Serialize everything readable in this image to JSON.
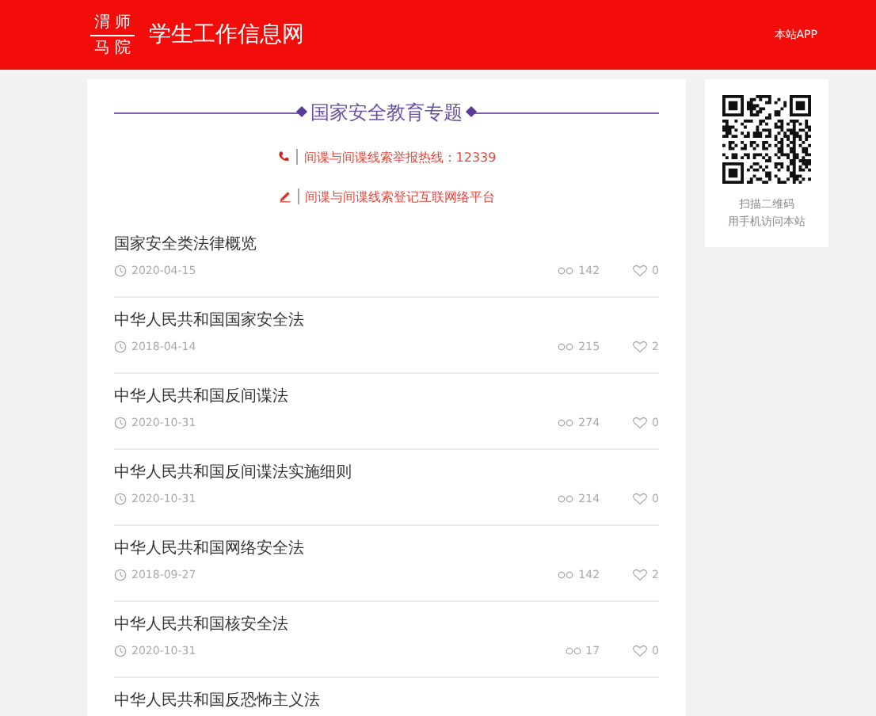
{
  "header": {
    "logo_lines": [
      "渭 师",
      "马 院"
    ],
    "site_title": "学生工作信息网",
    "app_link": "本站APP"
  },
  "topic": {
    "title": "国家安全教育专题",
    "notices": [
      {
        "kind": "phone",
        "text": "间谍与间谍线索举报热线：12339"
      },
      {
        "kind": "pen",
        "text": "间谍与间谍线索登记互联网络平台"
      }
    ]
  },
  "articles": [
    {
      "title": "国家安全类法律概览",
      "date": "2020-04-15",
      "views": "142",
      "likes": "0"
    },
    {
      "title": "中华人民共和国国家安全法",
      "date": "2018-04-14",
      "views": "215",
      "likes": "2"
    },
    {
      "title": "中华人民共和国反间谍法",
      "date": "2020-10-31",
      "views": "274",
      "likes": "0"
    },
    {
      "title": "中华人民共和国反间谍法实施细则",
      "date": "2020-10-31",
      "views": "214",
      "likes": "0"
    },
    {
      "title": "中华人民共和国网络安全法",
      "date": "2018-09-27",
      "views": "142",
      "likes": "2"
    },
    {
      "title": "中华人民共和国核安全法",
      "date": "2020-10-31",
      "views": "17",
      "likes": "0"
    },
    {
      "title": "中华人民共和国反恐怖主义法"
    }
  ],
  "qr_card": {
    "caption_lines": [
      "扫描二维码",
      "用手机访问本站"
    ]
  }
}
